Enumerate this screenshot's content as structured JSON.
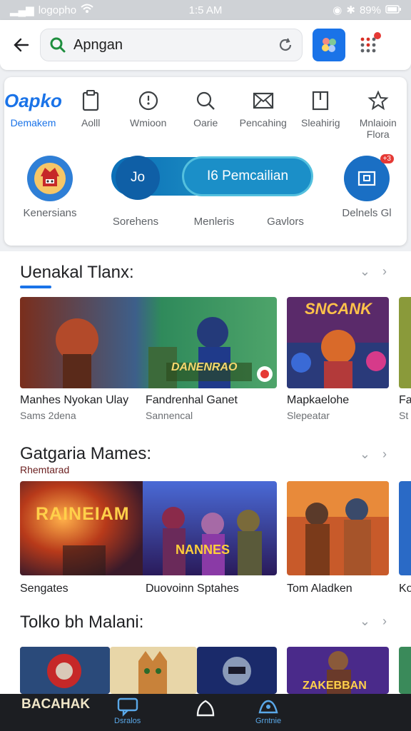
{
  "status": {
    "carrier": "logopho",
    "time": "1:5 AM",
    "battery": "89%"
  },
  "search": {
    "query": "Apngan"
  },
  "categories_top": [
    {
      "label": "Demakem",
      "brand": "Oapko"
    },
    {
      "label": "Aolll",
      "icon": "clipboard-icon"
    },
    {
      "label": "Wmioon",
      "icon": "clock-icon"
    },
    {
      "label": "Oarie",
      "icon": "search-icon"
    },
    {
      "label": "Pencahing",
      "icon": "envelope-icon"
    },
    {
      "label": "Sleahirig",
      "icon": "book-icon"
    },
    {
      "label": "Mnlaioin Flora",
      "icon": "star-icon"
    }
  ],
  "categories_bottom": [
    {
      "label": "Kenersians"
    },
    {
      "label": "Sorehens",
      "circle_text": "Jo"
    },
    {
      "label": "Menleris",
      "pill_text": "I6 Pemcailian"
    },
    {
      "label": "Gavlors"
    },
    {
      "label": "Delnels Gl",
      "badge": "+3"
    }
  ],
  "sections": [
    {
      "title": "Uenakal Tlanx:",
      "items": [
        {
          "title": "Manhes Nyokan Ulay",
          "sub": "Sams 2dena"
        },
        {
          "title": "Fandrenhal Ganet",
          "sub": "Sannencal",
          "art_text": "DANENRAO"
        },
        {
          "title": "Mapkaelohe",
          "sub": "Slepeatar",
          "art_text": "SNCANK"
        },
        {
          "title": "Fa",
          "sub": "St"
        }
      ]
    },
    {
      "title": "Gatgaria Mames:",
      "subtitle": "Rhemtarad",
      "items": [
        {
          "title": "Sengates",
          "sub": "",
          "art_text": "RAINEIAM"
        },
        {
          "title": "Duovoinn Sptahes",
          "sub": "",
          "art_text": "NANNES"
        },
        {
          "title": "Tom Aladken",
          "sub": ""
        },
        {
          "title": "Ko",
          "sub": ""
        }
      ]
    },
    {
      "title": "Tolko bh Malani:",
      "items": [
        {
          "title": "",
          "sub": ""
        },
        {
          "title": "",
          "sub": ""
        },
        {
          "title": "",
          "sub": ""
        },
        {
          "title": "",
          "sub": "",
          "art_text": "ZAKEBBAN"
        }
      ]
    }
  ],
  "bottom_nav": {
    "game_text": "BACAHAK",
    "items": [
      "Dsralos",
      "Grntnie"
    ]
  },
  "colors": {
    "accent": "#1a73e8",
    "badge": "#e53935"
  }
}
